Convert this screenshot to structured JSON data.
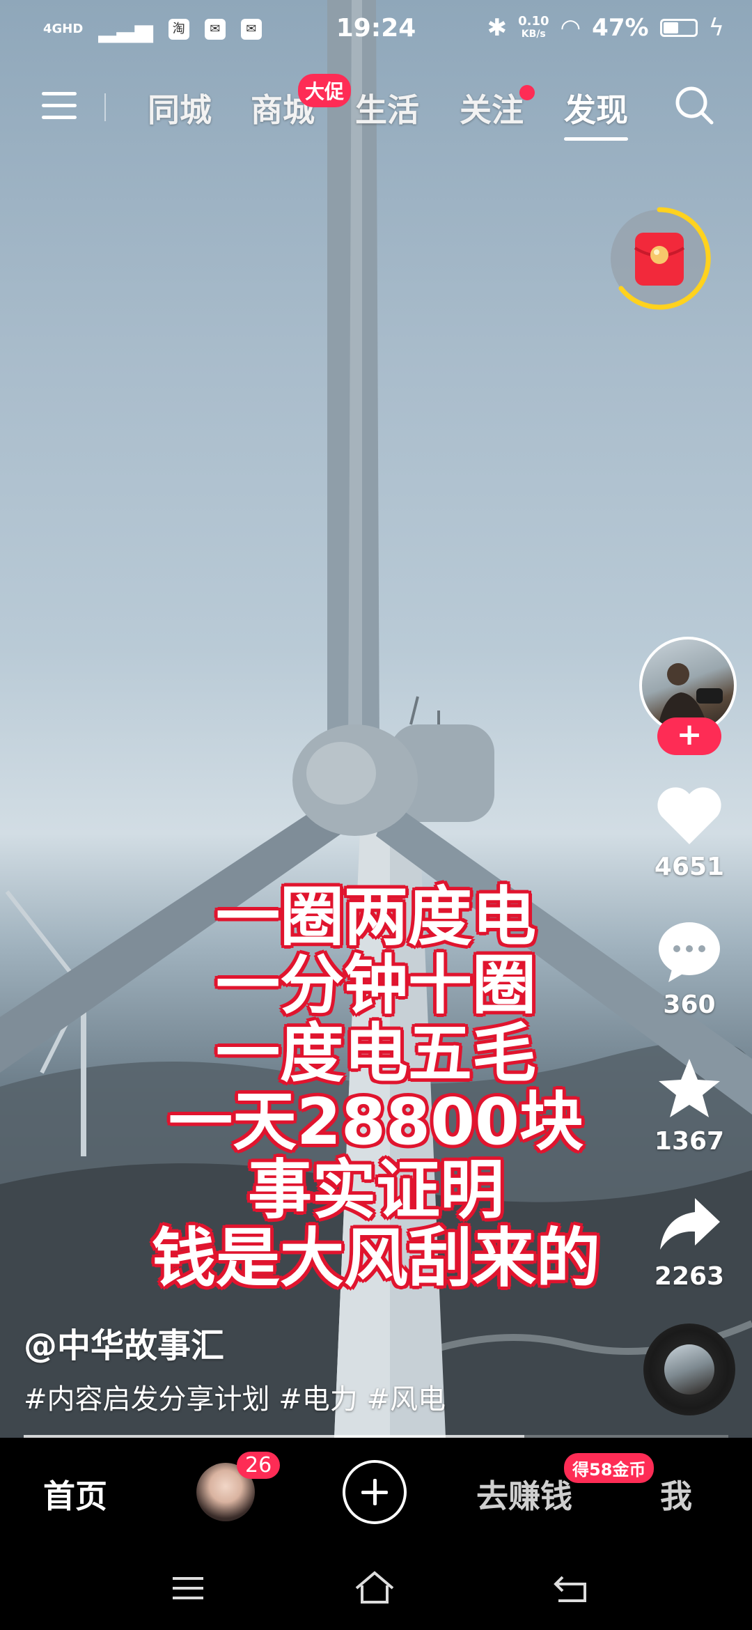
{
  "status_bar": {
    "network": "4GHD",
    "app_icons": [
      "淘"
    ],
    "time": "19:24",
    "speed_value": "0.10",
    "speed_unit": "KB/s",
    "battery": "47%",
    "battery_level": 0.47
  },
  "top_nav": {
    "tabs": [
      "同城",
      "商城",
      "生活",
      "关注",
      "发现"
    ],
    "active_tab": "发现",
    "promo_badge": "大促"
  },
  "video": {
    "caption_lines": [
      "一圈两度电",
      "一分钟十圈",
      "一度电五毛",
      "一天28800块",
      "事实证明",
      "钱是大风刮来的"
    ],
    "author": "@中华故事汇",
    "hashtags": "#内容启发分享计划 #电力 #风电",
    "progress": 0.71
  },
  "actions": {
    "follow_label": "+",
    "likes": "4651",
    "comments": "360",
    "favorites": "1367",
    "shares": "2263"
  },
  "bottom_tabs": {
    "home": "首页",
    "friends_badge": "26",
    "earn": "去赚钱",
    "earn_badge": "得58金币",
    "me": "我"
  },
  "colors": {
    "accent": "#fe2c55",
    "caption_outline": "#e0142e"
  }
}
